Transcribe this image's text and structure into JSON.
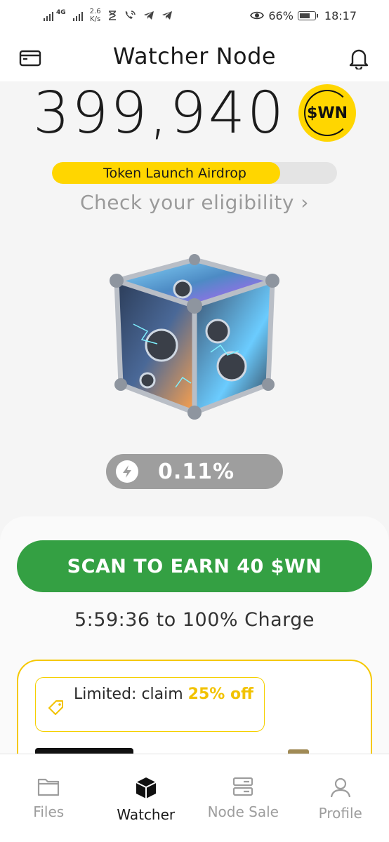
{
  "status_bar": {
    "network_type": "4G",
    "net_speed_value": "2.6",
    "net_speed_unit": "K/s",
    "battery_percent": "66%",
    "time": "18:17"
  },
  "header": {
    "title": "Watcher Node",
    "left_icon": "wallet-icon",
    "right_icon": "bell-icon"
  },
  "balance": {
    "amount": "399,940",
    "token_symbol": "$WN"
  },
  "airdrop": {
    "label": "Token Launch Airdrop",
    "progress": 0.8,
    "eligibility_link": "Check your eligibility",
    "chevron": "›"
  },
  "charge": {
    "value": "0.11%",
    "icon": "bolt-icon"
  },
  "scan_button": {
    "label": "SCAN TO EARN 40 $WN"
  },
  "countdown": {
    "text": "5:59:36 to 100% Charge"
  },
  "promo": {
    "text_prefix": "Limited: claim ",
    "highlight": "25% off",
    "icon": "tag-icon"
  },
  "bottom_nav": {
    "items": [
      {
        "label": "Files",
        "icon": "folder-icon",
        "active": false
      },
      {
        "label": "Watcher",
        "icon": "cube-icon",
        "active": true
      },
      {
        "label": "Node Sale",
        "icon": "server-icon",
        "active": false
      },
      {
        "label": "Profile",
        "icon": "person-icon",
        "active": false
      }
    ]
  },
  "colors": {
    "accent_yellow": "#ffd600",
    "scan_green": "#34a043",
    "charge_gray": "#9e9e9e"
  }
}
